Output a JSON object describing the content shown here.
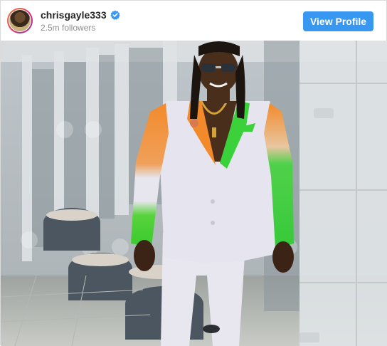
{
  "post": {
    "username": "chrisgayle333",
    "followers": "2.5m followers",
    "view_profile_label": "View Profile",
    "avatar_icon": "profile-avatar",
    "verified_icon": "verified-badge-icon"
  },
  "photo": {
    "subject": "man-in-white-suit-with-orange-and-green-sleeves"
  },
  "colors": {
    "accent": "#3897f0",
    "username": "#262626",
    "muted": "#8e8e8e",
    "suit": "#e6e4ee",
    "orange": "#f28a2b",
    "green": "#3ad13a"
  }
}
